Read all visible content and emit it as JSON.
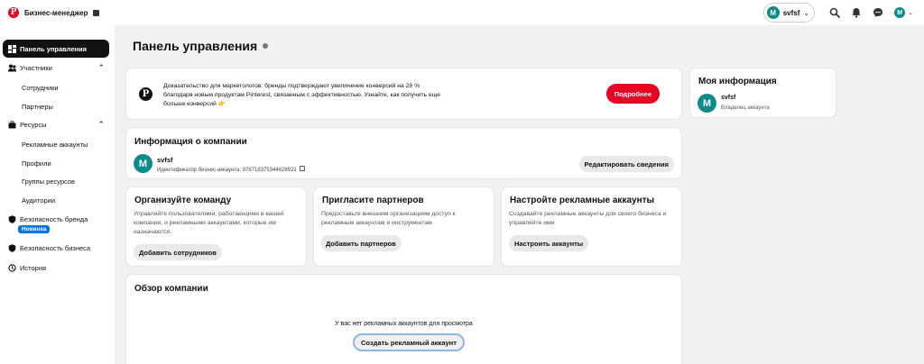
{
  "header": {
    "app_name": "Бизнес-менеджер",
    "account_name": "svfsf",
    "account_initial": "M",
    "user_initial": "M"
  },
  "sidebar": {
    "dashboard": "Панель управления",
    "members": "Участники",
    "employees": "Сотрудники",
    "partners": "Партнеры",
    "resources": "Ресурсы",
    "ad_accounts": "Рекламные аккаунты",
    "profiles": "Профили",
    "resource_groups": "Группы ресурсов",
    "audiences": "Аудитории",
    "brand_safety": "Безопасность бренда",
    "new_badge": "Новинка",
    "business_safety": "Безопасность бизнеса",
    "history": "История"
  },
  "main": {
    "title": "Панель управления",
    "banner": {
      "text": "Доказательство для маркетологов: бренды подтверждают увеличение конверсий на 28 % благодаря новым продуктам Pinterest, связанным с эффективностью. Узнайте, как получить еще больше конверсий 👉",
      "button": "Подробнее"
    },
    "company": {
      "title": "Информация о компании",
      "name": "svfsf",
      "id_text": "Идентификатор бизнес-аккаунта: 976718375344628921",
      "edit_button": "Редактировать сведения"
    },
    "team": {
      "title": "Организуйте команду",
      "desc": "Управляйте пользователями, работающими в вашей компании, и рекламными аккаунтами, которые им назначаются.",
      "button": "Добавить сотрудников"
    },
    "partners": {
      "title": "Пригласите партнеров",
      "desc": "Предоставьте внешним организациям доступ к рекламным аккаунтам и инструментам",
      "button": "Добавить партнеров"
    },
    "ads": {
      "title": "Настройте рекламные аккаунты",
      "desc": "Создавайте рекламные аккаунты для своего бизнеса и управляйте ими",
      "button": "Настроить аккаунты"
    },
    "overview": {
      "title": "Обзор компании",
      "empty": "У вас нет рекламных аккаунтов для просмотра",
      "button": "Создать рекламный аккаунт"
    }
  },
  "myinfo": {
    "title": "Моя информация",
    "initial": "M",
    "name": "svfsf",
    "role": "Владелец аккаунта"
  }
}
